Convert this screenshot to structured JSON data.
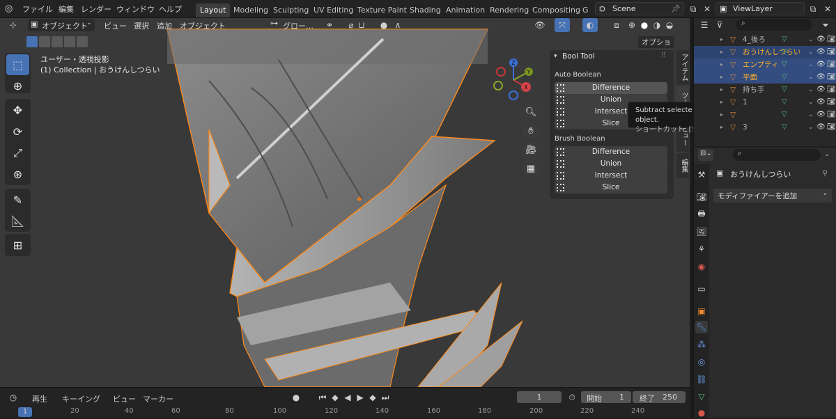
{
  "topbar": {
    "menus": [
      "ファイル",
      "編集",
      "レンダー",
      "ウィンドウ",
      "ヘルプ"
    ],
    "workspace_tabs": [
      "Layout",
      "Modeling",
      "Sculpting",
      "UV Editing",
      "Texture Paint",
      "Shading",
      "Animation",
      "Rendering",
      "Compositing",
      "G"
    ],
    "active_tab": "Layout",
    "scene": "Scene",
    "view_layer": "ViewLayer"
  },
  "viewport_header": {
    "mode": "オブジェクト",
    "menus": [
      "ビュー",
      "選択",
      "追加",
      "オブジェクト"
    ],
    "transform": "グロー…",
    "options": "オプション"
  },
  "viewport": {
    "view_name": "ユーザー・透視投影",
    "collection_info": "(1) Collection | おうけんしつらい",
    "gizmo": {
      "x": "X",
      "y": "Y",
      "z": "Z"
    }
  },
  "side_tabs": [
    "アイテム",
    "ツール",
    "ビュー",
    "編集"
  ],
  "bool_tool": {
    "title": "Bool Tool",
    "auto_label": "Auto Boolean",
    "auto_buttons": [
      "Difference",
      "Union",
      "Intersect",
      "Slice"
    ],
    "brush_label": "Brush Boolean",
    "brush_buttons": [
      "Difference",
      "Union",
      "Intersect",
      "Slice"
    ]
  },
  "tooltip": {
    "line1": "Subtract selected objects from active object.",
    "line2": "ショートカット: [Shift] [Ctrl] テンキー[ - ]"
  },
  "outliner": {
    "rows": [
      {
        "label": "4_後ろ",
        "state": "normal"
      },
      {
        "label": "おうけんしつらい",
        "state": "active"
      },
      {
        "label": "エンプティ",
        "state": "selected"
      },
      {
        "label": "平面",
        "state": "selected"
      },
      {
        "label": "持ち手",
        "state": "normal"
      },
      {
        "label": "1",
        "state": "normal"
      },
      {
        "label": "",
        "state": "normal"
      },
      {
        "label": "3",
        "state": "normal"
      }
    ]
  },
  "properties": {
    "object_name": "おうけんしつらい",
    "add_modifier": "モディファイアーを追加"
  },
  "timeline": {
    "menus": [
      "再生",
      "キーイング",
      "ビュー",
      "マーカー"
    ],
    "current_frame": "1",
    "start_label": "開始",
    "start": "1",
    "end_label": "終了",
    "end": "250",
    "ticks": [
      "1",
      "20",
      "40",
      "60",
      "80",
      "100",
      "120",
      "140",
      "160",
      "180",
      "200",
      "220",
      "240"
    ]
  },
  "colors": {
    "selection_outline": "#ff8a1a",
    "active_blue": "#4772b3",
    "panel_bg": "#2d2d2d",
    "viewport_bg": "#393939"
  }
}
